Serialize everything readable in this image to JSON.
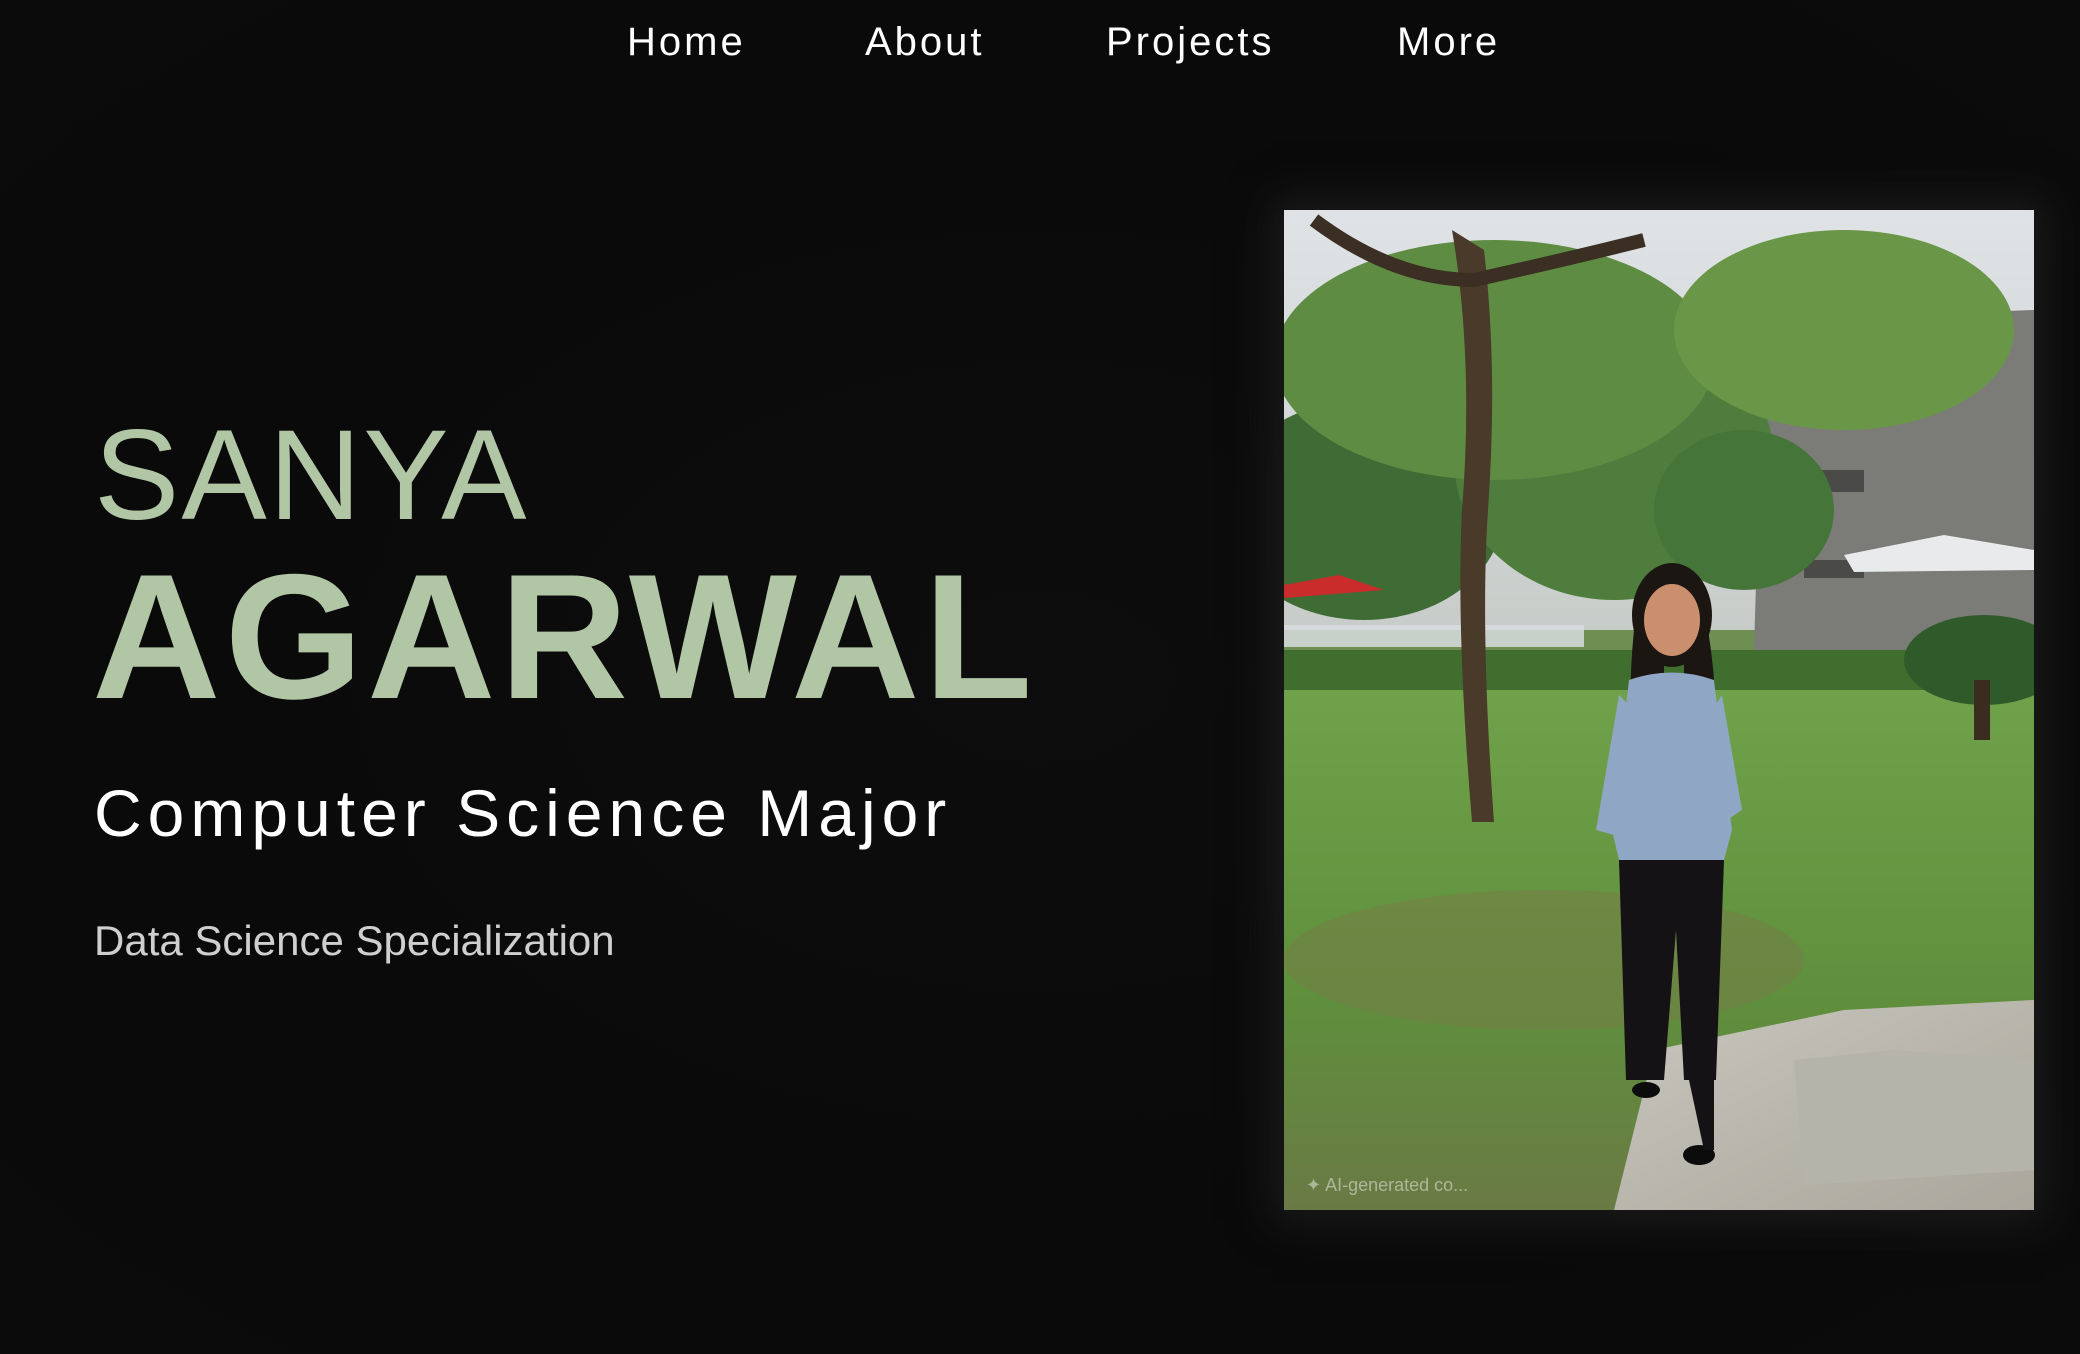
{
  "nav": {
    "items": [
      {
        "label": "Home"
      },
      {
        "label": "About"
      },
      {
        "label": "Projects"
      },
      {
        "label": "More"
      }
    ]
  },
  "hero": {
    "first_name": "SANYA",
    "last_name": "AGARWAL",
    "major": "Computer Science Major",
    "specialization": "Data Science Specialization",
    "accent_color": "#b1c6a5"
  },
  "photo": {
    "watermark": "✦ AI-generated co..."
  }
}
